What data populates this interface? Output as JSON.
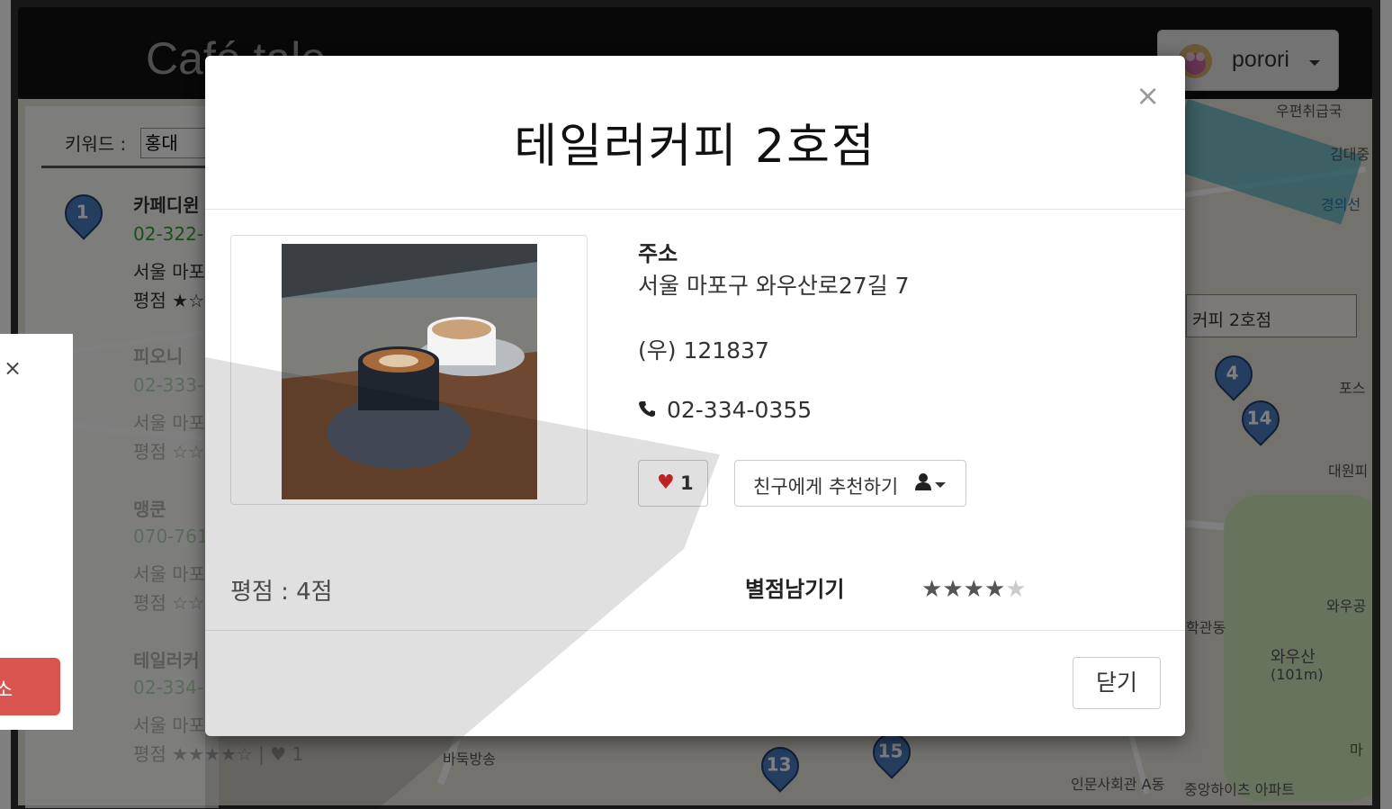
{
  "navbar": {
    "brand": "Café tale",
    "user_name": "porori"
  },
  "list": {
    "keyword_label": "키워드 :",
    "keyword_value": "홍대",
    "items": [
      {
        "name": "카페디윈",
        "phone": "02-322-",
        "address": "서울 마포",
        "rating": "평점 ★☆"
      },
      {
        "name": "피오니",
        "phone": "02-333-",
        "address": "서울 마포",
        "rating": "평점 ☆☆"
      },
      {
        "name": "맹쿤",
        "phone": "070-761",
        "address": "서울 마포",
        "rating": "평점 ☆☆"
      },
      {
        "name": "테일러커",
        "phone": "02-334-",
        "address": "서울 마포",
        "rating": "평점 ★★★★☆ | ♥ 1"
      }
    ]
  },
  "map": {
    "labels": [
      "우편취급국",
      "김대중",
      "경의선",
      "커피 2호점",
      "포스",
      "대원피\n아피",
      "와우공",
      "학관동",
      "와우산",
      "(101m)",
      "인문사회관\nA동",
      "중앙하이츠\n아파트",
      "바둑방송",
      "마"
    ],
    "pins": [
      "1",
      "4",
      "14",
      "13",
      "15"
    ]
  },
  "ghost_modal": {
    "button_label": "소"
  },
  "modal": {
    "title": "테일러커피 2호점",
    "address_label": "주소",
    "address": "서울 마포구 와우산로27길 7",
    "zip": "(우) 121837",
    "phone": "02-334-0355",
    "like_count": "1",
    "recommend_label": "친구에게 추천하기",
    "rating_text": "평점 : 4점",
    "rate_label": "별점남기기",
    "rating_value": 4,
    "rating_max": 5,
    "close_label": "닫기"
  },
  "colors": {
    "accent_red": "#d9534f",
    "pin_blue": "#4a7cc0",
    "navbar": "#111111"
  },
  "icons": {
    "close": "close-icon",
    "heart": "heart-icon",
    "phone": "phone-icon",
    "user": "user-icon",
    "caret": "caret-down-icon"
  }
}
